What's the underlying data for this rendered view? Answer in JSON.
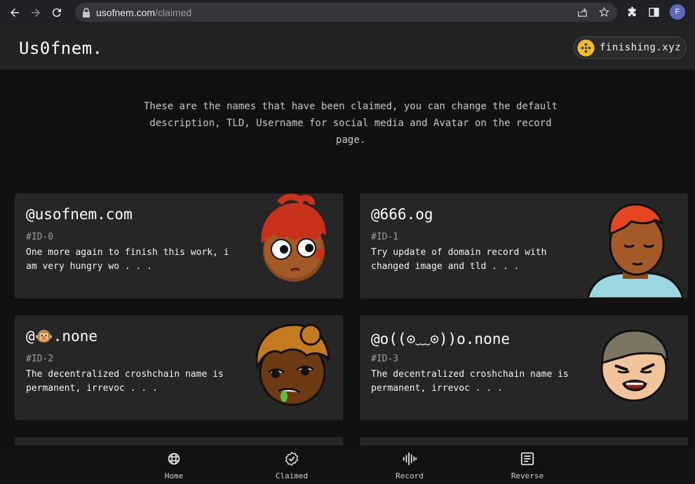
{
  "browser": {
    "url_host": "usofnem.com",
    "url_path": "/claimed",
    "profile_initial": "F"
  },
  "header": {
    "logo": "Us0fnem.",
    "wallet_label": "finishing.xyz"
  },
  "intro": {
    "text": "These are the names that have been claimed, you can change the default description, TLD, Username for social media and Avatar on the record page."
  },
  "cards": [
    {
      "name": "@usofnem.com",
      "id": "#ID-0",
      "description": "One more again to finish this work, i am very hungry wo . . ."
    },
    {
      "name": "@666.og",
      "id": "#ID-1",
      "description": "Try update of domain record with changed image and tld . . ."
    },
    {
      "name": "@🐵.none",
      "id": "#ID-2",
      "description": "The decentralized croshchain name is permanent, irrevoc . . ."
    },
    {
      "name": "@o((⊙﹏⊙))o.none",
      "id": "#ID-3",
      "description": "The decentralized croshchain name is permanent, irrevoc . . ."
    }
  ],
  "bottom_nav": {
    "tabs": [
      {
        "label": "Home",
        "icon": "grid-globe-icon"
      },
      {
        "label": "Claimed",
        "icon": "check-badge-icon"
      },
      {
        "label": "Record",
        "icon": "soundwave-icon"
      },
      {
        "label": "Reverse",
        "icon": "list-document-icon"
      }
    ]
  },
  "colors": {
    "background": "#111111",
    "card": "#262626",
    "header": "#232323",
    "wallet_coin": "#f3ba2f"
  }
}
